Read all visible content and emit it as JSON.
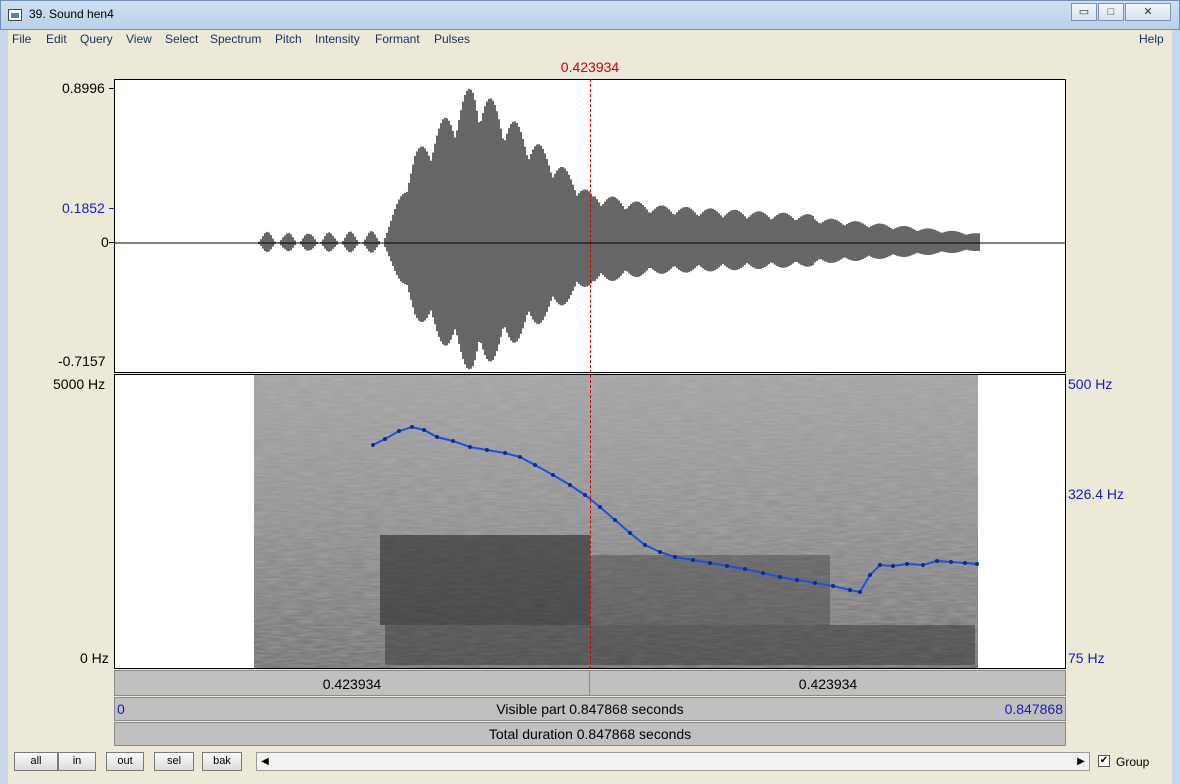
{
  "window": {
    "title": "39. Sound hen4",
    "controls": {
      "minimize": "▭",
      "maximize": "□",
      "close": "✕"
    }
  },
  "menu": [
    "File",
    "Edit",
    "Query",
    "View",
    "Select",
    "Spectrum",
    "Pitch",
    "Intensity",
    "Formant",
    "Pulses"
  ],
  "help": "Help",
  "cursor_time": "0.423934",
  "waveform": {
    "top": "0.8996",
    "mark": "0.1852",
    "zero": "0",
    "bottom": "-0.7157"
  },
  "spectrogram": {
    "freq_top": "5000 Hz",
    "freq_bottom": "0 Hz",
    "pitch_top": "500 Hz",
    "pitch_mid": "326.4 Hz",
    "pitch_bottom": "75 Hz"
  },
  "time_bars": {
    "left_cursor": "0.423934",
    "right_cursor": "0.423934",
    "visible_start": "0",
    "visible_label": "Visible part 0.847868 seconds",
    "visible_end": "0.847868",
    "total_label": "Total duration 0.847868 seconds"
  },
  "buttons": [
    "all",
    "in",
    "out",
    "sel",
    "bak"
  ],
  "group": {
    "label": "Group",
    "checked": true
  },
  "colors": {
    "cursor": "#d40000",
    "pitch": "#1a1ab8",
    "pitch_track": "#1f4fe0"
  }
}
